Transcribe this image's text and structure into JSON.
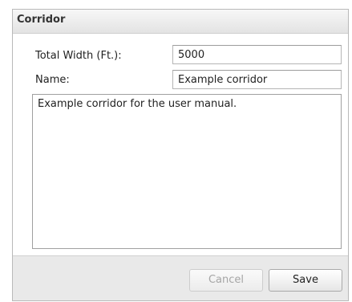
{
  "dialog": {
    "title": "Corridor"
  },
  "form": {
    "total_width_label": "Total Width (Ft.):",
    "total_width_value": "5000",
    "name_label": "Name:",
    "name_value": "Example corridor",
    "description_value": "Example corridor for the user manual."
  },
  "footer": {
    "cancel_label": "Cancel",
    "save_label": "Save",
    "cancel_disabled": true
  }
}
